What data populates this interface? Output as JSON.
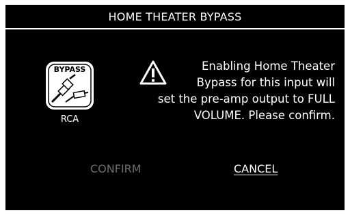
{
  "dialog": {
    "title": "HOME THEATER BYPASS",
    "icon": {
      "name": "bypass-rca-icon",
      "badge_text": "BYPASS",
      "label": "RCA"
    },
    "warning_icon": "warning-triangle-icon",
    "message_lines": [
      "Enabling Home Theater",
      "Bypass for this input will",
      "set the pre-amp output to FULL",
      "VOLUME.  Please confirm."
    ],
    "buttons": {
      "confirm_label": "CONFIRM",
      "cancel_label": "CANCEL"
    }
  },
  "colors": {
    "background": "#000000",
    "text": "#ffffff",
    "disabled_text": "#6e6e6e"
  }
}
